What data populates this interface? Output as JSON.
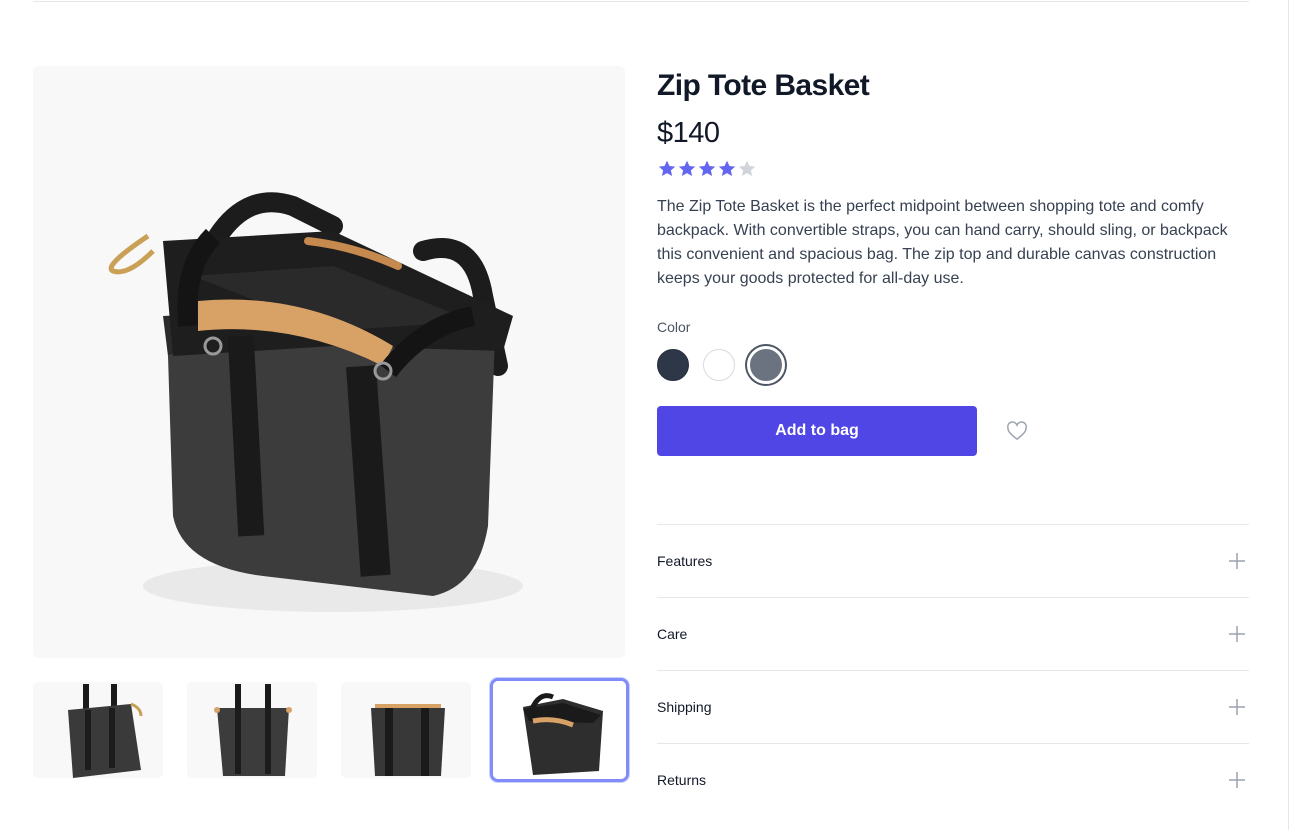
{
  "product": {
    "title": "Zip Tote Basket",
    "price": "$140",
    "rating": 4,
    "rating_max": 5,
    "description": "The Zip Tote Basket is the perfect midpoint between shopping tote and comfy backpack. With convertible straps, you can hand carry, should sling, or backpack this convenient and spacious bag. The zip top and durable canvas construction keeps your goods protected for all-day use."
  },
  "color": {
    "label": "Color",
    "options": [
      {
        "hex": "#2d3748"
      },
      {
        "hex": "#ffffff"
      },
      {
        "hex": "#6b7280",
        "selected": true
      }
    ]
  },
  "actions": {
    "add_to_bag": "Add to bag",
    "favorite_icon": "heart-icon"
  },
  "accordion": [
    {
      "label": "Features",
      "icon": "plus-icon"
    },
    {
      "label": "Care",
      "icon": "plus-icon"
    },
    {
      "label": "Shipping",
      "icon": "plus-icon"
    },
    {
      "label": "Returns",
      "icon": "plus-icon"
    }
  ],
  "gallery": {
    "selected_index": 3,
    "thumbnail_count": 4
  },
  "colors": {
    "accent": "#4f46e5",
    "star_filled": "#6366f1",
    "star_empty": "#d1d5db"
  }
}
